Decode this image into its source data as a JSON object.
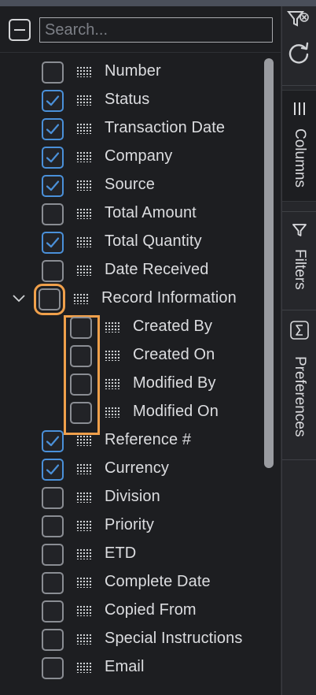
{
  "search": {
    "placeholder": "Search..."
  },
  "columns": [
    {
      "label": "Number",
      "checked": false
    },
    {
      "label": "Status",
      "checked": true
    },
    {
      "label": "Transaction Date",
      "checked": true
    },
    {
      "label": "Company",
      "checked": true
    },
    {
      "label": "Source",
      "checked": true
    },
    {
      "label": "Total Amount",
      "checked": false
    },
    {
      "label": "Total Quantity",
      "checked": true
    },
    {
      "label": "Date Received",
      "checked": false
    },
    {
      "label": "Record Information",
      "checked": false,
      "group": true,
      "expanded": true
    },
    {
      "label": "Created By",
      "checked": false,
      "child": true
    },
    {
      "label": "Created On",
      "checked": false,
      "child": true
    },
    {
      "label": "Modified By",
      "checked": false,
      "child": true
    },
    {
      "label": "Modified On",
      "checked": false,
      "child": true
    },
    {
      "label": "Reference #",
      "checked": true
    },
    {
      "label": "Currency",
      "checked": true
    },
    {
      "label": "Division",
      "checked": false
    },
    {
      "label": "Priority",
      "checked": false
    },
    {
      "label": "ETD",
      "checked": false
    },
    {
      "label": "Complete Date",
      "checked": false
    },
    {
      "label": "Copied From",
      "checked": false
    },
    {
      "label": "Special Instructions",
      "checked": false
    },
    {
      "label": "Email",
      "checked": false
    }
  ],
  "side_tabs": [
    {
      "label": "Columns",
      "icon": "columns-icon",
      "active": true
    },
    {
      "label": "Filters",
      "icon": "filter-icon",
      "active": false
    },
    {
      "label": "Preferences",
      "icon": "sigma-icon",
      "active": false
    }
  ],
  "colors": {
    "accent": "#4a90d9",
    "highlight": "#f0a04b",
    "background": "#1d1e21"
  }
}
